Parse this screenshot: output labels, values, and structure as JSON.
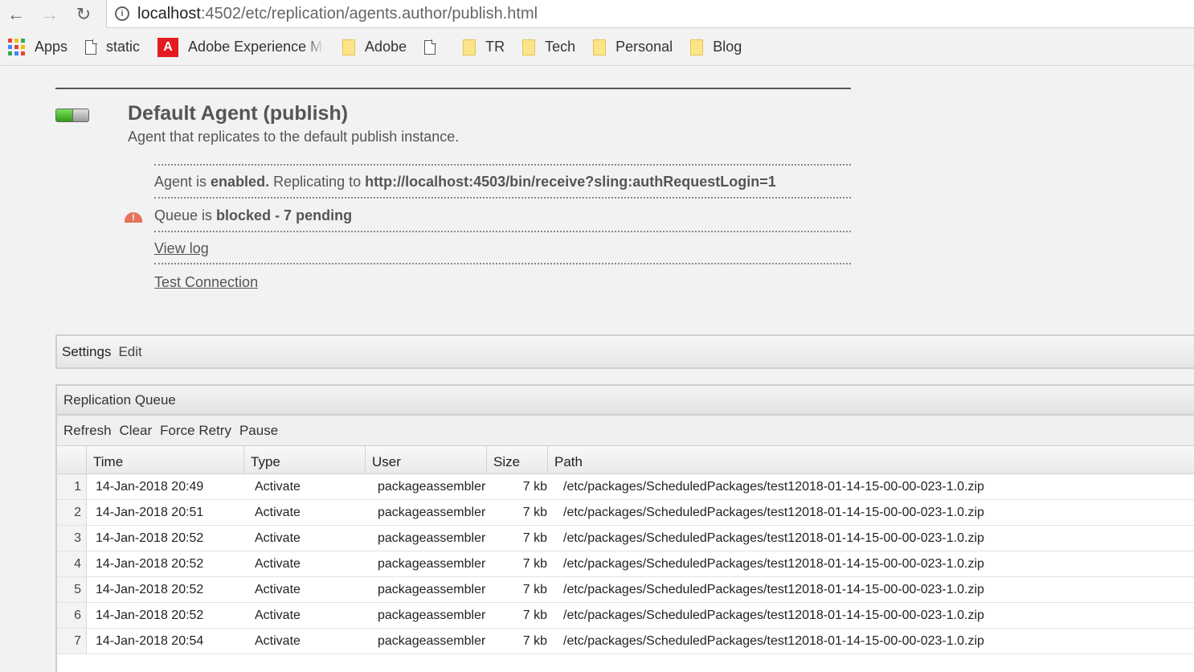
{
  "browser": {
    "url_host": "localhost",
    "url_rest": ":4502/etc/replication/agents.author/publish.html",
    "bookmarks": [
      {
        "label": "Apps",
        "icon": "apps-grid-icon"
      },
      {
        "label": "static",
        "icon": "document-icon"
      },
      {
        "label": "Adobe Experience Ma",
        "icon": "adobe-logo-icon"
      },
      {
        "label": "Adobe",
        "icon": "folder-icon"
      },
      {
        "label": "",
        "icon": "document-icon"
      },
      {
        "label": "TR",
        "icon": "folder-icon"
      },
      {
        "label": "Tech",
        "icon": "folder-icon"
      },
      {
        "label": "Personal",
        "icon": "folder-icon"
      },
      {
        "label": "Blog",
        "icon": "folder-icon"
      }
    ]
  },
  "agent": {
    "title": "Default Agent (publish)",
    "description": "Agent that replicates to the default publish instance.",
    "status_prefix": "Agent is ",
    "status_value": "enabled.",
    "replicating_label": " Replicating to ",
    "replicating_url": "http://localhost:4503/bin/receive?sling:authRequestLogin=1",
    "queue_prefix": "Queue is ",
    "queue_value": "blocked - 7 pending",
    "view_log": "View log",
    "test_connection": "Test Connection"
  },
  "settings": {
    "title": "Settings",
    "edit": "Edit"
  },
  "queue": {
    "title": "Replication Queue",
    "toolbar": [
      "Refresh",
      "Clear",
      "Force Retry",
      "Pause"
    ],
    "columns": [
      "Time",
      "Type",
      "User",
      "Size",
      "Path"
    ],
    "rows": [
      {
        "n": "1",
        "time": "14-Jan-2018 20:49",
        "type": "Activate",
        "user": "packageassembler",
        "size": "7 kb",
        "path": "/etc/packages/ScheduledPackages/test12018-01-14-15-00-00-023-1.0.zip"
      },
      {
        "n": "2",
        "time": "14-Jan-2018 20:51",
        "type": "Activate",
        "user": "packageassembler",
        "size": "7 kb",
        "path": "/etc/packages/ScheduledPackages/test12018-01-14-15-00-00-023-1.0.zip"
      },
      {
        "n": "3",
        "time": "14-Jan-2018 20:52",
        "type": "Activate",
        "user": "packageassembler",
        "size": "7 kb",
        "path": "/etc/packages/ScheduledPackages/test12018-01-14-15-00-00-023-1.0.zip"
      },
      {
        "n": "4",
        "time": "14-Jan-2018 20:52",
        "type": "Activate",
        "user": "packageassembler",
        "size": "7 kb",
        "path": "/etc/packages/ScheduledPackages/test12018-01-14-15-00-00-023-1.0.zip"
      },
      {
        "n": "5",
        "time": "14-Jan-2018 20:52",
        "type": "Activate",
        "user": "packageassembler",
        "size": "7 kb",
        "path": "/etc/packages/ScheduledPackages/test12018-01-14-15-00-00-023-1.0.zip"
      },
      {
        "n": "6",
        "time": "14-Jan-2018 20:52",
        "type": "Activate",
        "user": "packageassembler",
        "size": "7 kb",
        "path": "/etc/packages/ScheduledPackages/test12018-01-14-15-00-00-023-1.0.zip"
      },
      {
        "n": "7",
        "time": "14-Jan-2018 20:54",
        "type": "Activate",
        "user": "packageassembler",
        "size": "7 kb",
        "path": "/etc/packages/ScheduledPackages/test12018-01-14-15-00-00-023-1.0.zip"
      }
    ]
  },
  "colors": {
    "toggle_on": "#2f9e1b",
    "warning": "#e8735f",
    "adobe_red": "#e31b23",
    "folder": "#fbe48a"
  }
}
